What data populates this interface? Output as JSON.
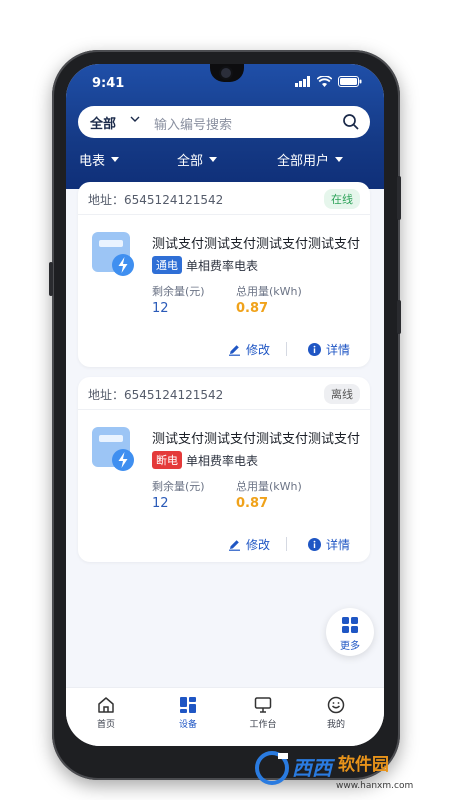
{
  "status_bar": {
    "time": "9:41"
  },
  "search": {
    "scope": "全部",
    "placeholder": "输入编号搜索"
  },
  "filters": [
    {
      "label": "电表"
    },
    {
      "label": "全部"
    },
    {
      "label": "全部用户"
    }
  ],
  "cards": [
    {
      "address_label": "地址：",
      "address": "6545124121542",
      "status": "在线",
      "title": "测试支付测试支付测试支付测试支付",
      "power_tag": "通电",
      "meter_type": "单相费率电表",
      "remaining_label": "剩余量(元)",
      "remaining_value": "12",
      "usage_label": "总用量(kWh)",
      "usage_value": "0.87",
      "edit_label": "修改",
      "detail_label": "详情"
    },
    {
      "address_label": "地址：",
      "address": "6545124121542",
      "status": "离线",
      "title": "测试支付测试支付测试支付测试支付",
      "power_tag": "断电",
      "meter_type": "单相费率电表",
      "remaining_label": "剩余量(元)",
      "remaining_value": "12",
      "usage_label": "总用量(kWh)",
      "usage_value": "0.87",
      "edit_label": "修改",
      "detail_label": "详情"
    }
  ],
  "fab": {
    "label": "更多"
  },
  "tabbar": [
    {
      "label": "首页",
      "icon": "home-icon"
    },
    {
      "label": "设备",
      "icon": "device-grid-icon",
      "active": true
    },
    {
      "label": "工作台",
      "icon": "monitor-icon"
    },
    {
      "label": "我的",
      "icon": "smile-icon"
    }
  ],
  "watermark": {
    "brand": "西西软件园",
    "url": "www.hanxm.com"
  },
  "colors": {
    "primary": "#1f56c4",
    "header": "#153a86",
    "online": "#2fa35a",
    "offline": "#777777",
    "power_on": "#2f6fd6",
    "power_off": "#e43a3a",
    "usage": "#f0a21a"
  }
}
